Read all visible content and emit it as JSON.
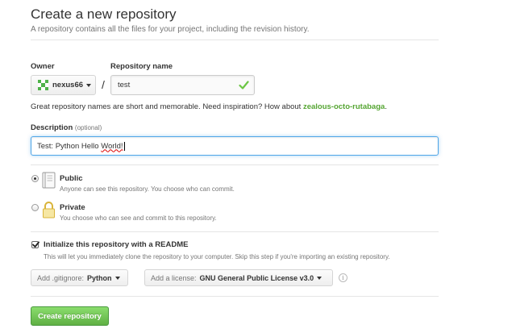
{
  "header": {
    "title": "Create a new repository",
    "subtitle": "A repository contains all the files for your project, including the revision history."
  },
  "owner": {
    "label": "Owner",
    "value": "nexus66",
    "icon": "identicon-avatar"
  },
  "separator": "/",
  "repository": {
    "label": "Repository name",
    "value": "test",
    "valid_icon": "check-icon",
    "valid_color": "#6cc644"
  },
  "hint": {
    "text": "Great repository names are short and memorable. Need inspiration? How about ",
    "suggestion": "zealous-octo-rutabaga",
    "suffix": "."
  },
  "description": {
    "label": "Description",
    "optional": "(optional)",
    "value_plain": "Test: Python Hello ",
    "value_misspelled": "World!"
  },
  "visibility": {
    "public": {
      "title": "Public",
      "note": "Anyone can see this repository. You choose who can commit.",
      "selected": true,
      "icon": "repo-book-icon"
    },
    "private": {
      "title": "Private",
      "note": "You choose who can see and commit to this repository.",
      "selected": false,
      "icon": "lock-icon"
    }
  },
  "init_readme": {
    "label": "Initialize this repository with a README",
    "note": "This will let you immediately clone the repository to your computer. Skip this step if you're importing an existing repository.",
    "checked": true
  },
  "gitignore": {
    "prefix": "Add .gitignore:",
    "value": "Python"
  },
  "license": {
    "prefix": "Add a license:",
    "value": "GNU General Public License v3.0"
  },
  "info_icon": "i",
  "submit": {
    "label": "Create repository",
    "color": "#60b044"
  }
}
